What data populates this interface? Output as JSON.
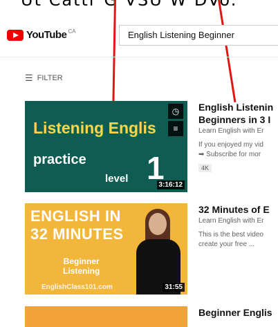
{
  "top_crop_text": "Ut Cattr G VSU W DVo.",
  "header": {
    "brand": "YouTube",
    "country_code": "CA",
    "search_value": "English Listening Beginner"
  },
  "filter_label": "FILTER",
  "results": [
    {
      "title": "English Listenin",
      "title_line2": "Beginners in 3 I",
      "channel": "Learn English with Er",
      "description_line1": "If you enjoyed my vid",
      "description_line2": "➡ Subscribe for mor",
      "badge": "4K",
      "duration": "3:16:12",
      "thumb": {
        "line1": "Listening Englis",
        "line2": "practice",
        "line3": "level",
        "line4": "1"
      }
    },
    {
      "title": "32 Minutes of E",
      "channel": "Learn English with Er",
      "description_line1": "This is the best video",
      "description_line2": "create your free ...",
      "duration": "31:55",
      "thumb": {
        "line1": "ENGLISH IN",
        "line2": "32 MINUTES",
        "line3": "Beginner",
        "line4": "Listening",
        "line5": "EnglishClass101.com"
      }
    },
    {
      "title": "Beginner Englis"
    }
  ],
  "colors": {
    "accent_red": "#e00000",
    "arrow_red": "#e41414"
  }
}
